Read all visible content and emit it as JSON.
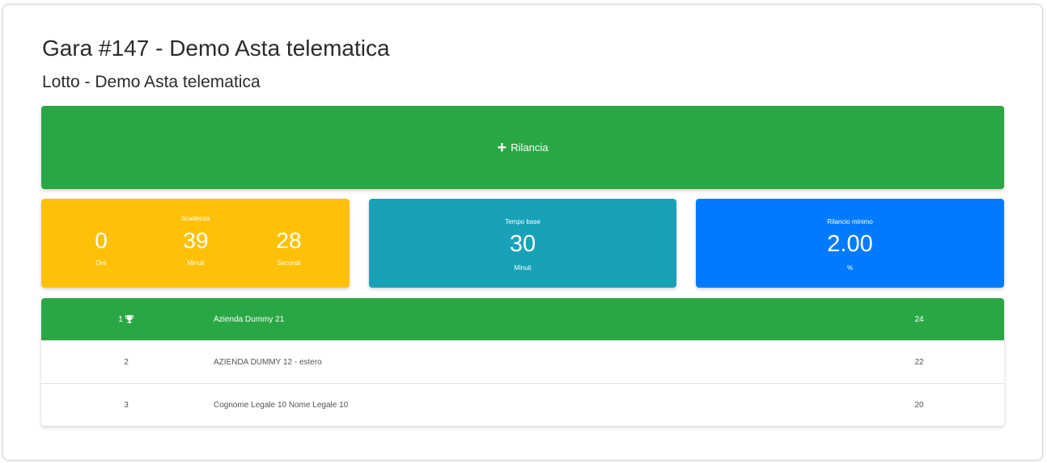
{
  "header": {
    "title": "Gara #147 - Demo Asta telematica",
    "subtitle": "Lotto - Demo Asta telematica"
  },
  "bid_button": {
    "icon": "plus-icon",
    "label": "Rilancia"
  },
  "deadline_card": {
    "title": "Scadenza",
    "hours": "0",
    "hours_label": "Ore",
    "minutes": "39",
    "minutes_label": "Minuti",
    "seconds": "28",
    "seconds_label": "Secondi",
    "color": "#ffc108"
  },
  "base_time_card": {
    "title": "Tempo base",
    "value": "30",
    "unit": "Minuti",
    "color": "#17a2b8"
  },
  "min_bid_card": {
    "title": "Rilancio minimo",
    "value": "2.00",
    "unit": "%",
    "color": "#007bff"
  },
  "ranking": {
    "winner_color": "#2aa745",
    "rows": [
      {
        "position": "1",
        "icon": "trophy-icon",
        "name": "Azienda Dummy 21",
        "score": "24"
      },
      {
        "position": "2",
        "name": "AZIENDA DUMMY 12 - estero",
        "score": "22"
      },
      {
        "position": "3",
        "name": "Cognome Legale 10 Nome Legale 10",
        "score": "20"
      }
    ]
  }
}
